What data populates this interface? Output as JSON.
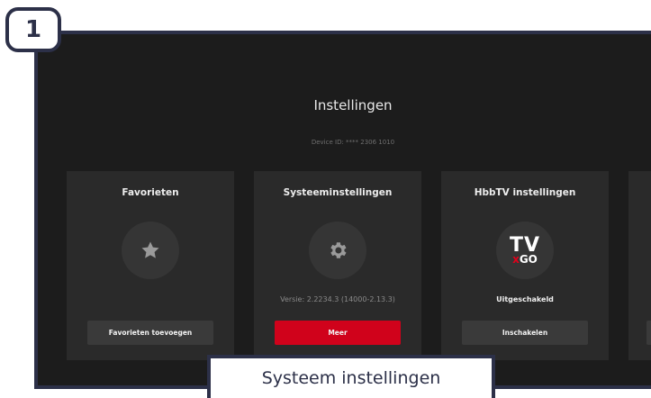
{
  "step": "1",
  "screen": {
    "title": "Instellingen",
    "device_id": "Device ID: **** 2306 1010"
  },
  "cards": [
    {
      "title": "Favorieten",
      "icon": "star-icon",
      "status": "",
      "button": "Favorieten toevoegen"
    },
    {
      "title": "Systeeminstellingen",
      "icon": "gear-icon",
      "status": "Versie: 2.2234.3 (14000-2.13.3)",
      "button": "Meer"
    },
    {
      "title": "HbbTV instellingen",
      "icon": "tvgo-logo",
      "logo_text": "TV GO",
      "status": "Uitgeschakeld",
      "button": "Inschakelen"
    }
  ],
  "caption": "Systeem instellingen",
  "colors": {
    "accent": "#d0021b",
    "frame": "#2c3048",
    "background": "#1c1c1c",
    "card": "#2a2a2a"
  }
}
